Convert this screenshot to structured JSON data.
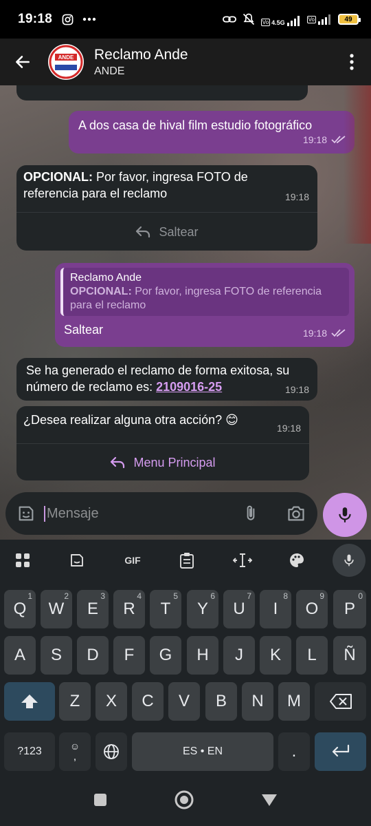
{
  "status_bar": {
    "time": "19:18",
    "battery": "49",
    "network": "4.5G"
  },
  "header": {
    "title": "Reclamo Ande",
    "subtitle": "ANDE",
    "avatar_text": "ANDE"
  },
  "messages": [
    {
      "type": "out",
      "text": "A dos casa de hival film estudio fotográfico",
      "time": "19:18"
    },
    {
      "type": "in",
      "bold": "OPCIONAL:",
      "text": " Por favor, ingresa FOTO de referencia para el reclamo",
      "time": "19:18",
      "button": "Saltear"
    },
    {
      "type": "out",
      "reply_name": "Reclamo Ande",
      "reply_bold": "OPCIONAL:",
      "reply_text": " Por favor, ingresa FOTO de referencia para el reclamo",
      "text": "Saltear",
      "time": "19:18"
    },
    {
      "type": "in",
      "text": "Se ha generado el reclamo de forma exitosa, su número de reclamo es: ",
      "link": "2109016-25",
      "time": "19:18"
    },
    {
      "type": "in",
      "text": "¿Desea realizar alguna otra acción? 😊",
      "time": "19:18",
      "button": "Menu Principal"
    }
  ],
  "composer": {
    "placeholder": "Mensaje"
  },
  "keyboard": {
    "toolbar": [
      "apps",
      "sticker",
      "GIF",
      "clipboard",
      "cursor",
      "palette",
      "mic"
    ],
    "row1": [
      [
        "Q",
        "1"
      ],
      [
        "W",
        "2"
      ],
      [
        "E",
        "3"
      ],
      [
        "R",
        "4"
      ],
      [
        "T",
        "5"
      ],
      [
        "Y",
        "6"
      ],
      [
        "U",
        "7"
      ],
      [
        "I",
        "8"
      ],
      [
        "O",
        "9"
      ],
      [
        "P",
        "0"
      ]
    ],
    "row2": [
      "A",
      "S",
      "D",
      "F",
      "G",
      "H",
      "J",
      "K",
      "L",
      "Ñ"
    ],
    "row3": [
      "Z",
      "X",
      "C",
      "V",
      "B",
      "N",
      "M"
    ],
    "symbols_key": "?123",
    "space_key": "ES • EN",
    "period_key": ".",
    "comma_key": ","
  },
  "colors": {
    "accent": "#cf95e6",
    "outgoing_bubble": "#7a3e8f",
    "incoming_bubble": "#212527",
    "link": "#d59cf0"
  }
}
